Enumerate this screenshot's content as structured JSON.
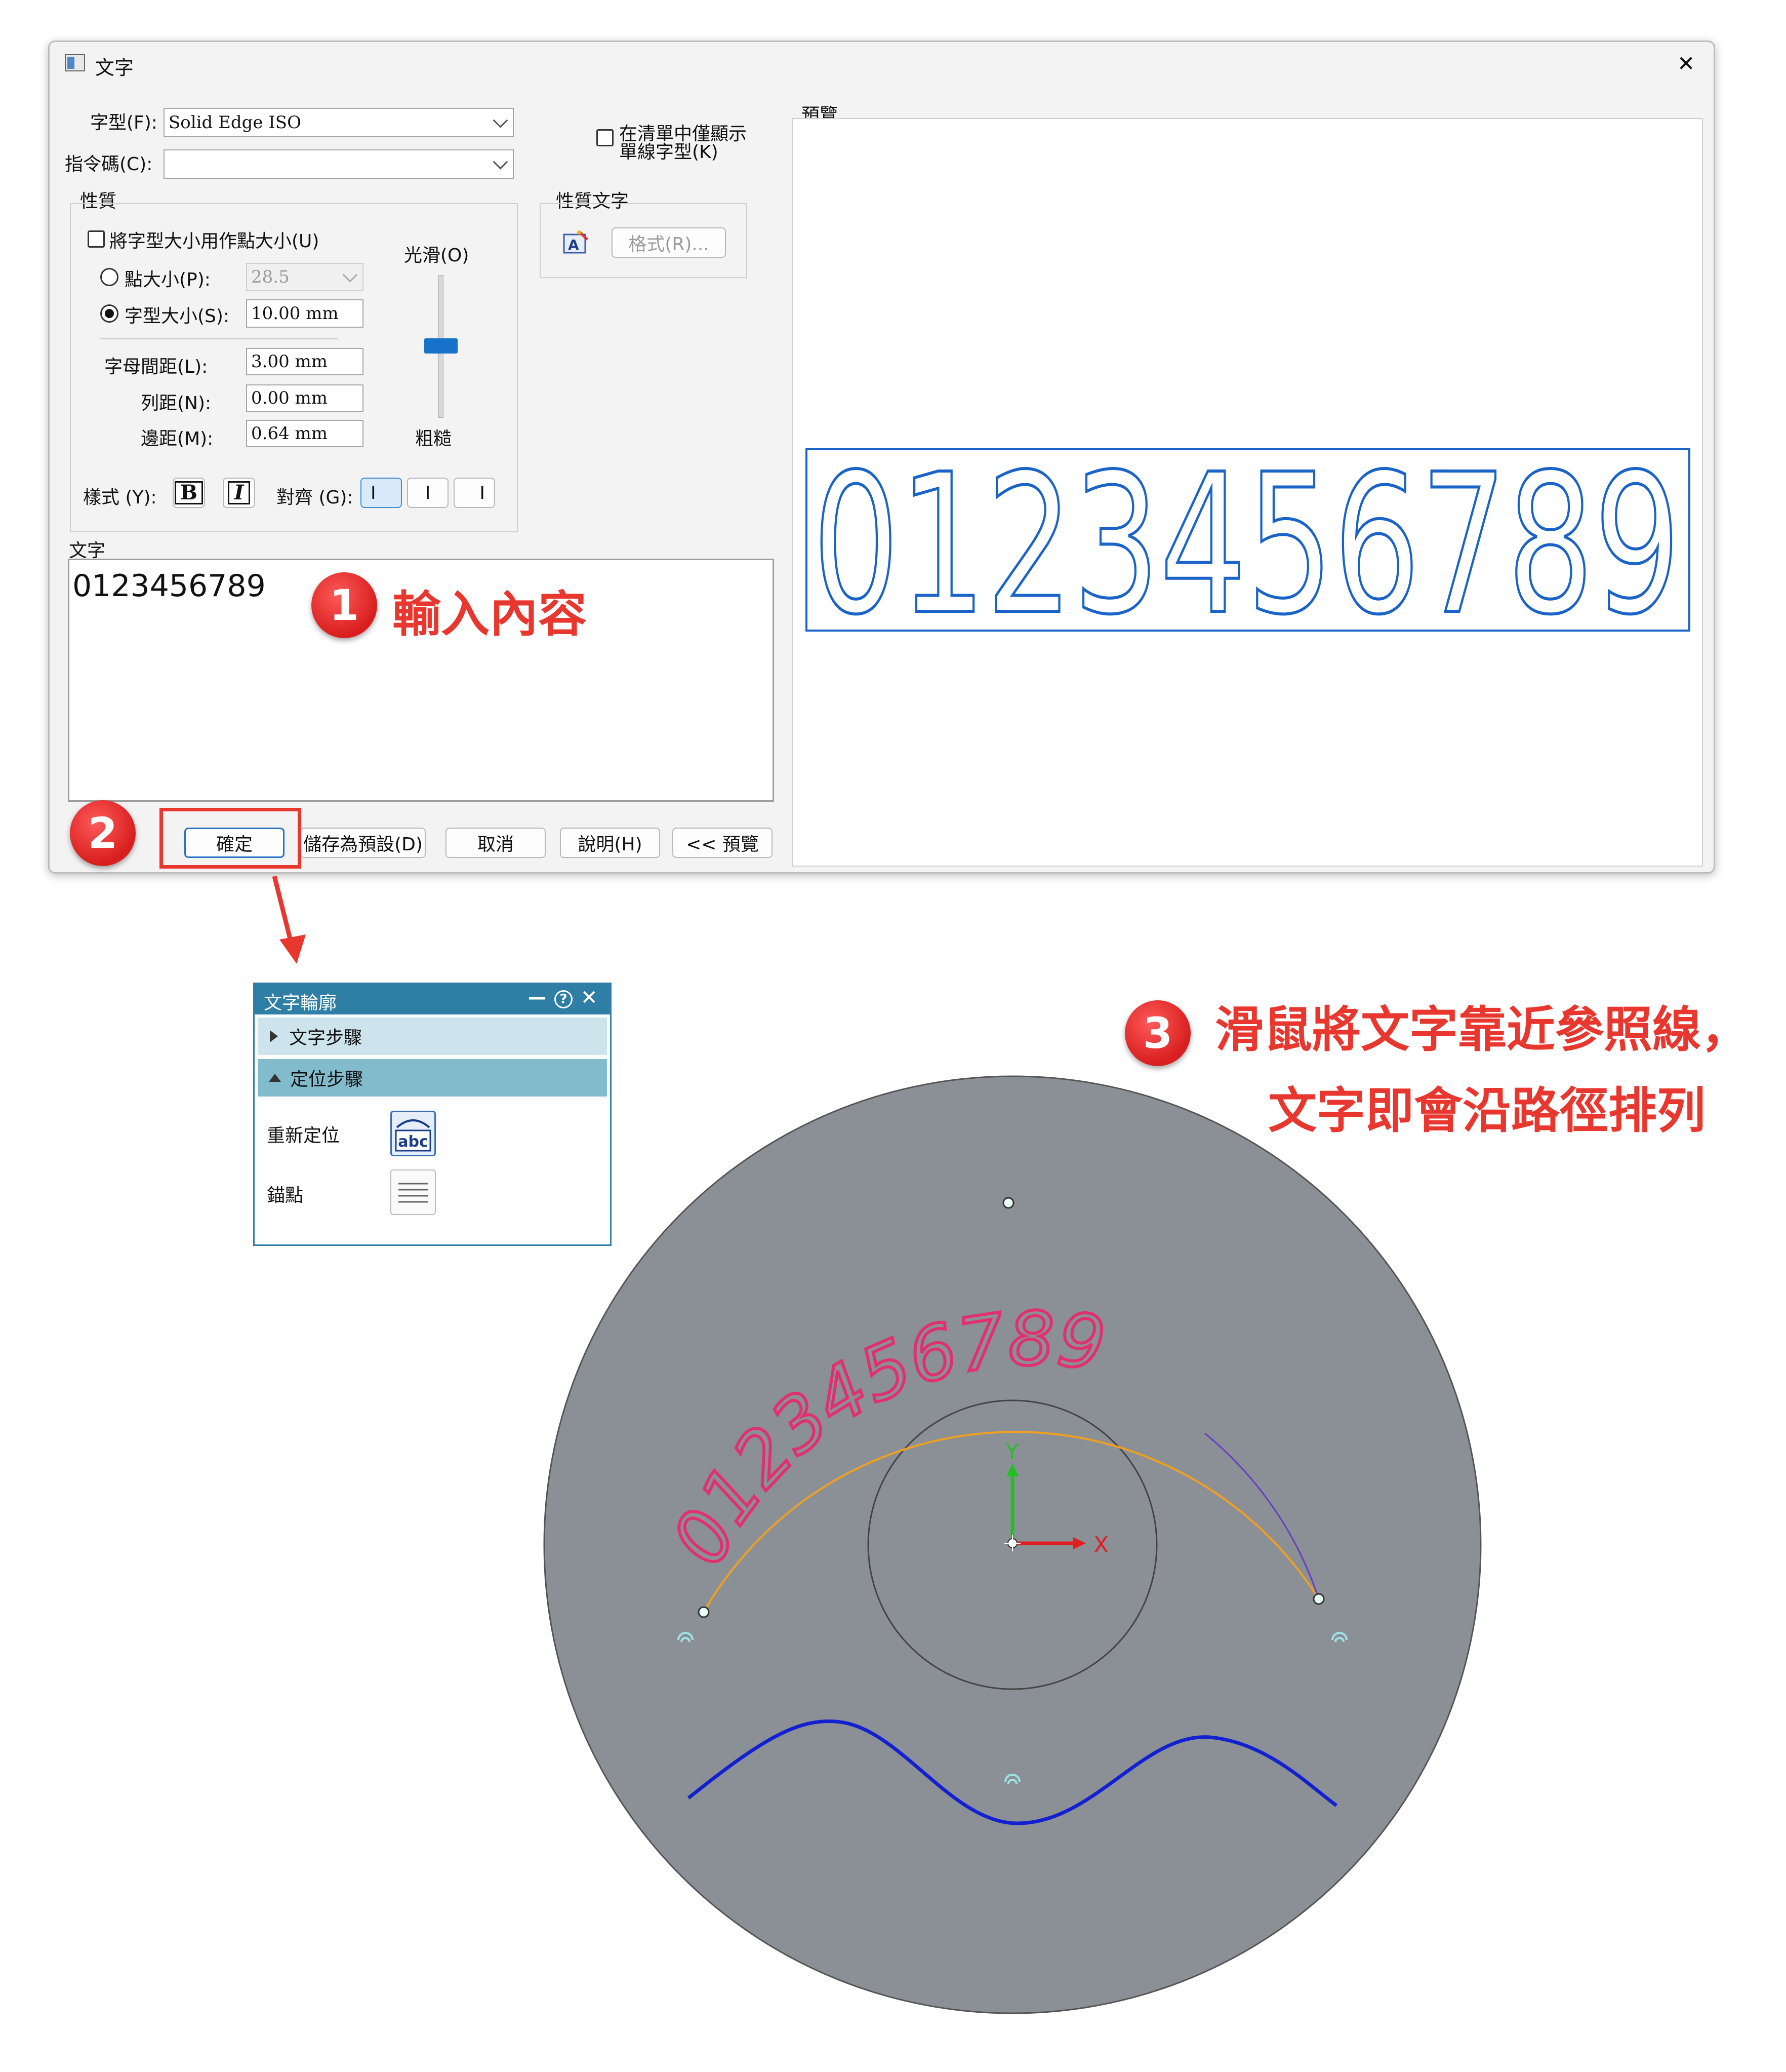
{
  "dialog": {
    "title": "文字",
    "close_glyph": "✕",
    "font_label": "字型(F):",
    "font_value": "Solid Edge ISO",
    "codepage_label": "指令碼(C):",
    "codepage_value": "",
    "single_line_only_label_1": "在清單中僅顯示",
    "single_line_only_label_2": "單線字型(K)",
    "properties_group": "性質",
    "use_font_size_as_point_label": "將字型大小用作點大小(U)",
    "point_size_label": "點大小(P):",
    "point_size_value": "28.5",
    "font_size_label": "字型大小(S):",
    "font_size_value": "10.00 mm",
    "char_spacing_label": "字母間距(L):",
    "char_spacing_value": "3.00 mm",
    "line_spacing_label": "列距(N):",
    "line_spacing_value": "0.00 mm",
    "margin_label": "邊距(M):",
    "margin_value": "0.64 mm",
    "smooth_label": "光滑(O)",
    "rough_label": "粗糙",
    "smoothness_fraction": 0.5,
    "style_label": "樣式 (Y):",
    "bold_glyph": "B",
    "italic_glyph": "I",
    "align_label": "對齊 (G):",
    "align_left_glyph": "I",
    "align_center_glyph": "I",
    "align_right_glyph": "I",
    "property_text_group": "性質文字",
    "format_button": "格式(R)...",
    "text_label": "文字",
    "text_value": "0123456789",
    "preview_label": "預覽",
    "preview_text": "0123456789",
    "buttons": {
      "ok": "確定",
      "save_default": "儲存為預設(D)",
      "cancel": "取消",
      "help": "說明(H)",
      "preview": "<< 預覽"
    }
  },
  "annotations": {
    "step1_number": "1",
    "step1_text": "輸入內容",
    "step2_number": "2",
    "step3_number": "3",
    "step3_text_line1": "滑鼠將文字靠近參照線，",
    "step3_text_line2": "文字即會沿路徑排列"
  },
  "text_profile_panel": {
    "title": "文字輪廓",
    "minimize_glyph": "—",
    "help_glyph": "?",
    "close_glyph": "✕",
    "step_text": "文字步驟",
    "step_position": "定位步驟",
    "reposition_label": "重新定位",
    "anchor_label": "錨點",
    "abc_icon_text": "abc"
  },
  "canvas": {
    "curved_text": "0123456789",
    "axis_x_label": "X",
    "axis_y_label": "Y",
    "colors": {
      "disc": "#8b9097",
      "curved_text": "#e0306d",
      "guide_arc": "#f0a020",
      "wave": "#1220d0",
      "axis_x": "#e02020",
      "axis_y": "#20c020",
      "preview_text": "#1a63c8",
      "annotation_red": "#e8372e"
    }
  }
}
